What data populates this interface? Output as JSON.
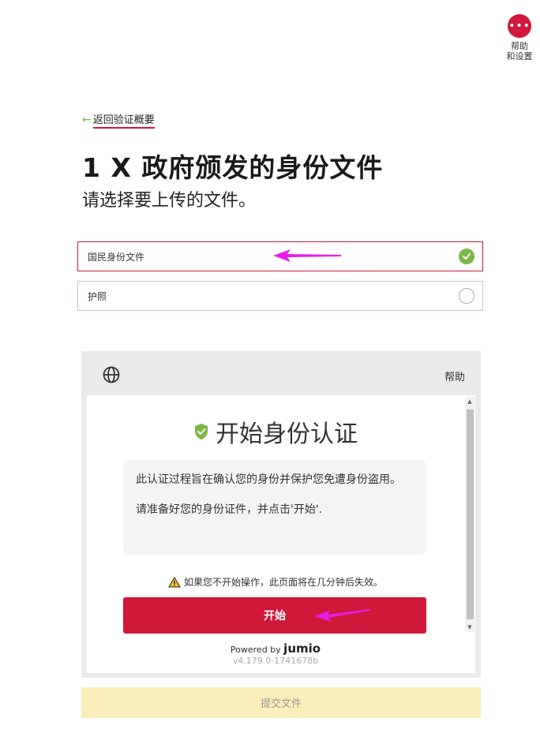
{
  "help_fab": {
    "dots": "•••",
    "label": "帮助\n和设置"
  },
  "back_link": {
    "arrow": "←",
    "label": "返回验证概要"
  },
  "title": "1 X 政府颁发的身份文件",
  "subtitle": "请选择要上传的文件。",
  "options": [
    {
      "label": "国民身份文件",
      "selected": true
    },
    {
      "label": "护照",
      "selected": false
    }
  ],
  "widget": {
    "help_label": "帮助",
    "title": "开始身份认证",
    "info_paragraphs": [
      "此认证过程旨在确认您的身份并保护您免遭身份盗用。",
      "请准备好您的身份证件，并点击'开始'."
    ],
    "warning": "如果您不开始操作，此页面将在几分钟后失效。",
    "start_label": "开始",
    "powered_prefix": "Powered by",
    "powered_brand": "jumio",
    "version": "v4.179.0-1741678b",
    "scroll_up": "▲",
    "scroll_down": "▼"
  },
  "submit_label": "提交文件",
  "colors": {
    "brand_red": "#d0183a",
    "check_green": "#7ab648",
    "submit_bg": "#fceeba",
    "annotation": "#e81ee8"
  }
}
